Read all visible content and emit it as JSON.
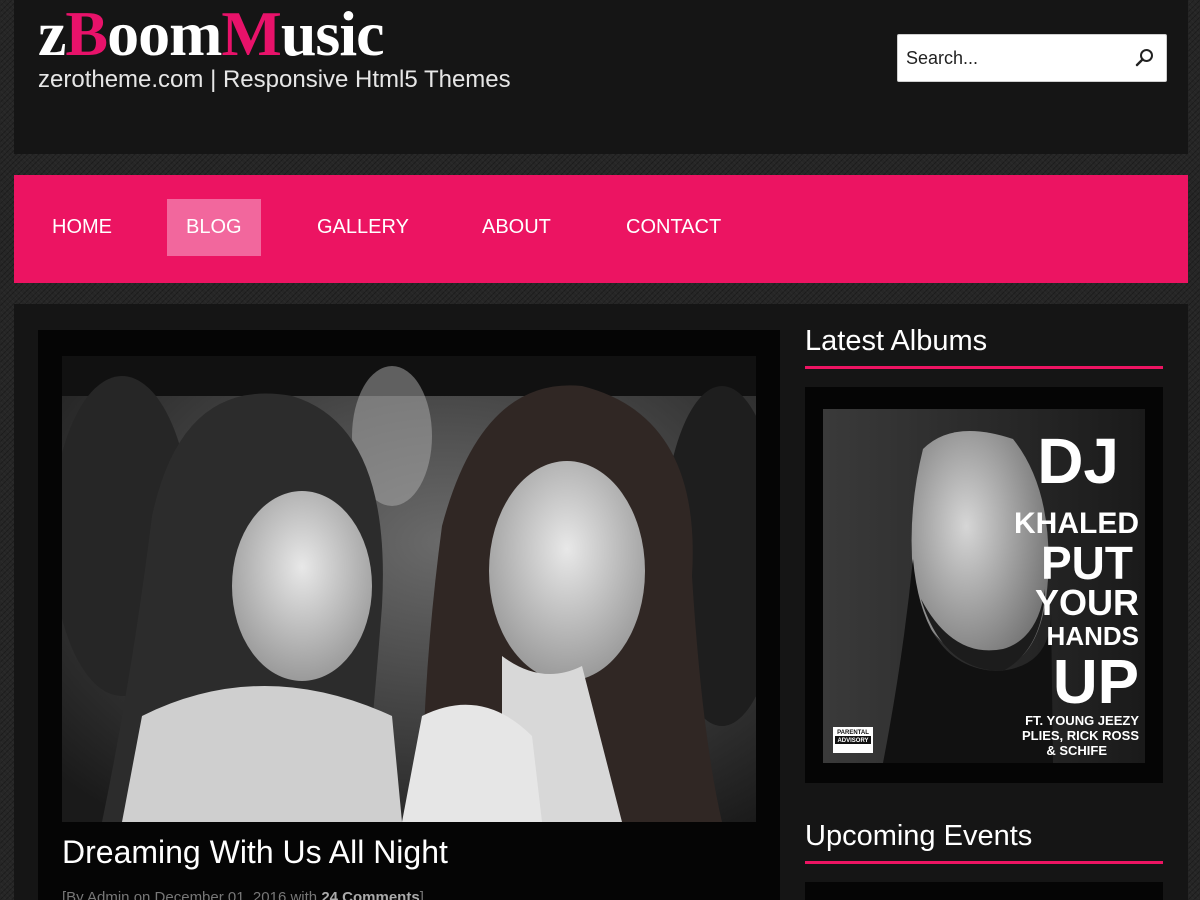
{
  "header": {
    "logo_parts": [
      "z",
      "B",
      "oom",
      "M",
      "usic"
    ],
    "tagline": "zerotheme.com | Responsive Html5 Themes",
    "search": {
      "placeholder": "Search...",
      "icon": "search-icon"
    }
  },
  "nav": {
    "items": [
      {
        "label": "HOME"
      },
      {
        "label": "BLOG",
        "active": true
      },
      {
        "label": "GALLERY"
      },
      {
        "label": "ABOUT"
      },
      {
        "label": "CONTACT"
      }
    ]
  },
  "post": {
    "title": "Dreaming With Us All Night",
    "meta_prefix": "[By Admin on December 01, 2016 with ",
    "meta_comments": "24 Comments",
    "meta_suffix": "]"
  },
  "sidebar": {
    "latest_albums_title": "Latest Albums",
    "album": {
      "line1": "DJ",
      "line2": "KHALED",
      "line3": "PUT",
      "line4": "YOUR",
      "line5": "HANDS",
      "line6": "UP",
      "featuring1": "FT. YOUNG JEEZY",
      "featuring2": "PLIES, RICK ROSS",
      "featuring3": "& SCHIFE",
      "advisory1": "PARENTAL",
      "advisory2": "ADVISORY"
    },
    "upcoming_events_title": "Upcoming Events"
  },
  "colors": {
    "accent": "#ec1462",
    "nav_active": "#f2679d",
    "panel": "#151515",
    "dark_box": "#050505"
  }
}
